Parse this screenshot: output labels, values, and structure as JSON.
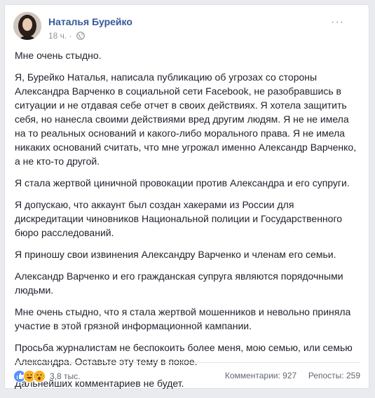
{
  "post": {
    "author": "Наталья Бурейко",
    "time": "18 ч.",
    "privacy_icon": "globe-icon",
    "more_icon": "more-dots-icon",
    "paragraphs": [
      "Мне очень стыдно.",
      "Я, Бурейко Наталья, написала публикацию об угрозах со стороны Александра Варченко в социальной сети Facebook, не разобравшись в ситуации и не отдавая себе отчет в своих действиях. Я хотела защитить себя, но нанесла своими действиями вред другим людям. Я не не имела на то реальных оснований и какого-либо морального права. Я не имела никаких оснований считать, что мне угрожал именно Александр Варченко, а не кто-то другой.",
      "Я стала жертвой циничной провокации против Александра и его супруги.",
      "Я допускаю, что аккаунт был создан хакерами из России для дискредитации чиновников Национальной полиции и Государственного бюро расследований.",
      "Я приношу свои извинения Александру Варченко и членам его семьи.",
      "Александр Варченко и его гражданская супруга являются порядочными людьми.",
      "Мне очень стыдно, что я стала жертвой мошенников и невольно приняла участие в этой грязной информационной кампании.",
      "Просьба журналистам не беспокоить более меня, мою семью, или семью Александра. Оставьте эту тему в покое.",
      "Дальнейших комментариев не будет."
    ]
  },
  "footer": {
    "reactions_count": "3,8 тыс.",
    "reaction_icons": [
      "like-icon",
      "haha-icon",
      "wow-icon"
    ],
    "comments": "Комментарии: 927",
    "shares": "Репосты: 259"
  },
  "colors": {
    "background": "#e9ebee",
    "author_link": "#365899",
    "like": "#5890ff",
    "haha": "#f7b125"
  }
}
